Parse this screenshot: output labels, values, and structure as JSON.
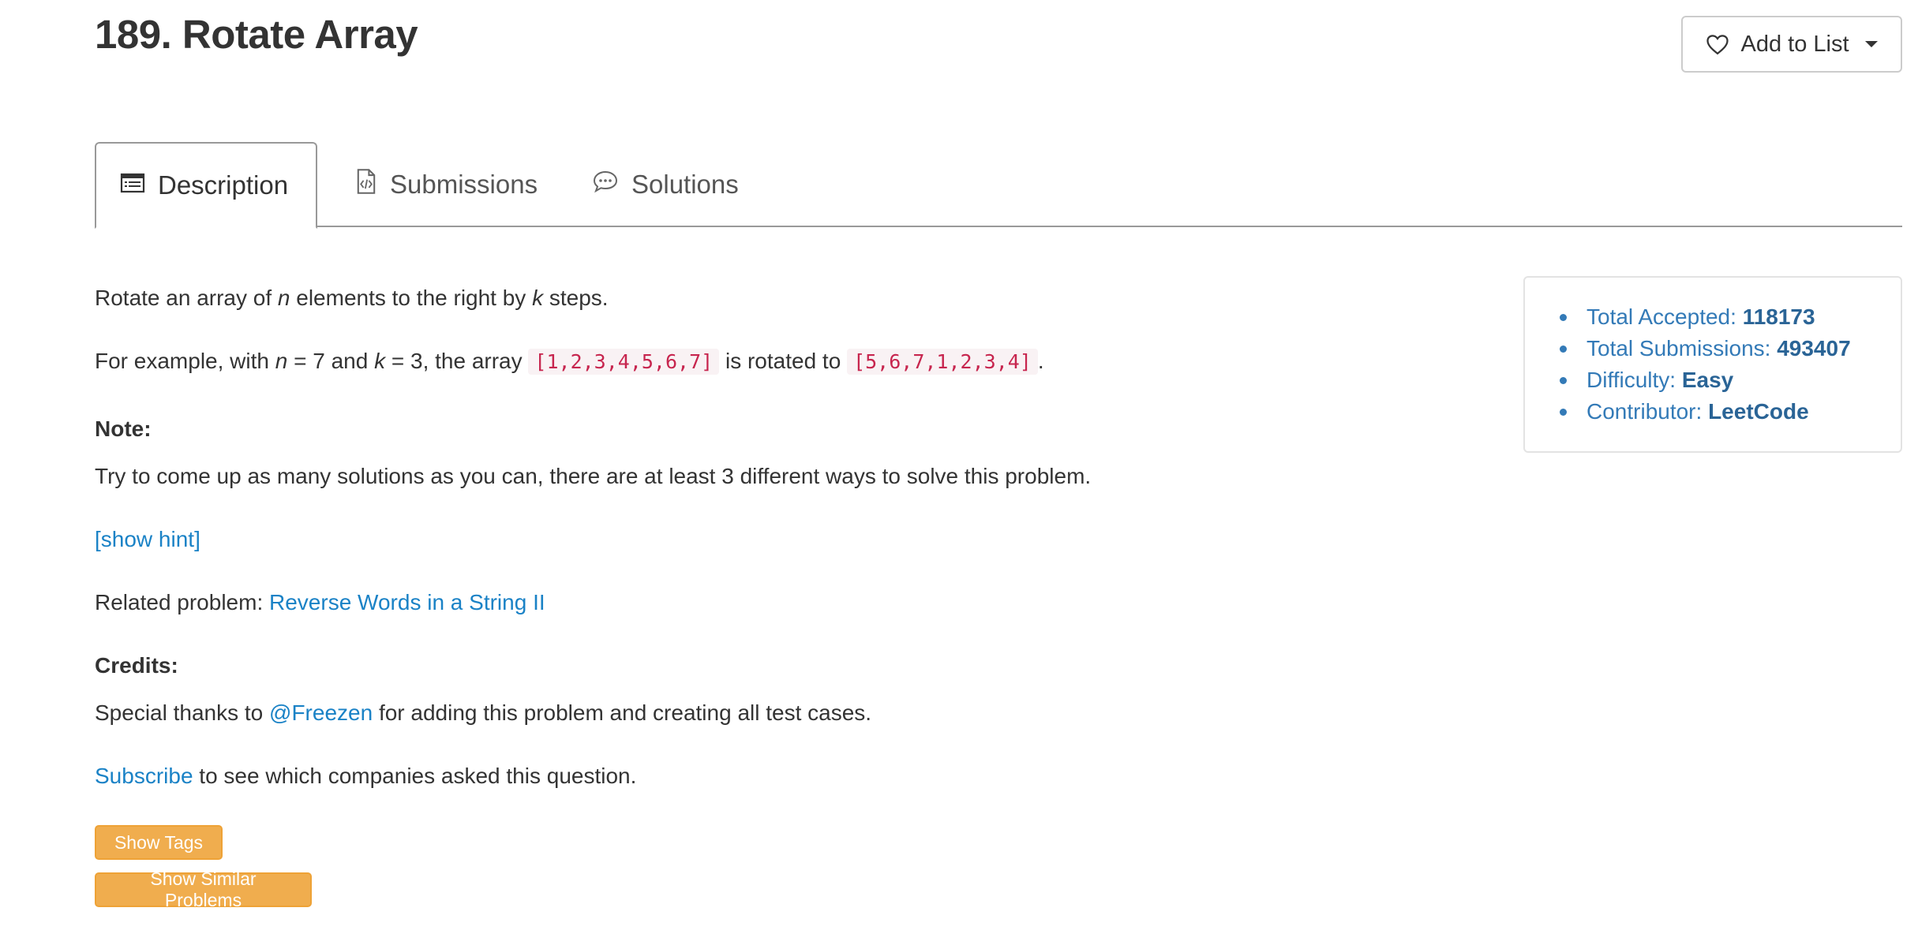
{
  "header": {
    "title": "189. Rotate Array",
    "add_to_list_label": "Add to List"
  },
  "tabs": [
    {
      "label": "Description",
      "icon": "list-icon",
      "active": true
    },
    {
      "label": "Submissions",
      "icon": "code-file-icon",
      "active": false
    },
    {
      "label": "Solutions",
      "icon": "chat-bubble-icon",
      "active": false
    }
  ],
  "description": {
    "intro_pre": "Rotate an array of ",
    "intro_n": "n",
    "intro_mid": " elements to the right by ",
    "intro_k": "k",
    "intro_post": " steps.",
    "example_pre": "For example, with ",
    "example_n": "n",
    "example_eq1": " = 7 and ",
    "example_k": "k",
    "example_eq2": " = 3, the array ",
    "example_code1": "[1,2,3,4,5,6,7]",
    "example_mid": " is rotated to ",
    "example_code2": "[5,6,7,1,2,3,4]",
    "example_post": ".",
    "note_heading": "Note:",
    "note_text": "Try to come up as many solutions as you can, there are at least 3 different ways to solve this problem.",
    "show_hint": "[show hint]",
    "related_pre": "Related problem: ",
    "related_link": "Reverse Words in a String II",
    "credits_heading": "Credits:",
    "thanks_pre": "Special thanks to ",
    "thanks_link": "@Freezen",
    "thanks_post": " for adding this problem and creating all test cases.",
    "subscribe_link": "Subscribe",
    "subscribe_post": " to see which companies asked this question."
  },
  "buttons": {
    "show_tags": "Show Tags",
    "show_similar": "Show Similar Problems"
  },
  "stats": {
    "accepted_label": "Total Accepted: ",
    "accepted_value": "118173",
    "submissions_label": "Total Submissions: ",
    "submissions_value": "493407",
    "difficulty_label": "Difficulty: ",
    "difficulty_value": "Easy",
    "contributor_label": "Contributor: ",
    "contributor_value": "LeetCode"
  },
  "colors": {
    "link": "#1a82c6",
    "code_text": "#c7254e",
    "code_bg": "#f9f2f4",
    "tag_button": "#f0ad4e",
    "stats_text": "#337ab7"
  }
}
